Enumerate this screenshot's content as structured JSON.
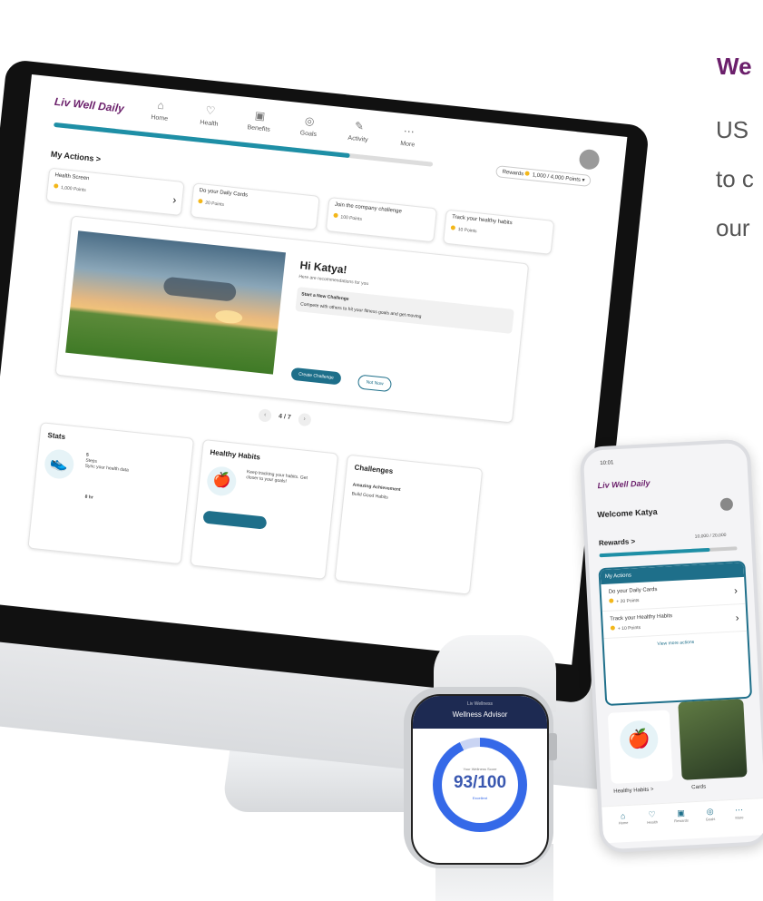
{
  "side_text": {
    "heading": "We",
    "line1": "US",
    "line2": "to c",
    "line3": "our"
  },
  "monitor": {
    "logo": "Liv Well Daily",
    "nav": [
      "Home",
      "Health",
      "Benefits",
      "Goals",
      "Activity",
      "More"
    ],
    "rewards_label": "Rewards",
    "rewards_value": "1,000 / 4,000 Points",
    "section_title": "My Actions >",
    "actions": [
      {
        "label": "Health Screen",
        "points": "1,000 Points"
      },
      {
        "label": "Do your Daily Cards",
        "points": "20 Points"
      },
      {
        "label": "Join the company challenge",
        "points": "100 Points"
      },
      {
        "label": "Track your healthy habits",
        "points": "10 Points"
      }
    ],
    "hero": {
      "greeting": "Hi Katya!",
      "subtitle": "Here are recommendations for you",
      "challenge_title": "Start a New Challenge",
      "challenge_text": "Compete with others to hit your fitness goals and get moving",
      "primary_btn": "Create Challenge",
      "secondary_btn": "Not Now"
    },
    "pager": "4 / 7",
    "stats": {
      "title": "Stats",
      "steps": "5",
      "steps_label": "Steps",
      "steps_sub": "Sync your health data",
      "sleep": "8 hr"
    },
    "habits": {
      "title": "Healthy Habits",
      "text": "Keep tracking your habits. Get closer to your goals!"
    },
    "challenges": {
      "title": "Challenges",
      "item": "Amazing Achievement",
      "sub": "Build Good Habits"
    }
  },
  "phone": {
    "time": "10:01",
    "logo": "Liv Well Daily",
    "welcome": "Welcome Katya",
    "rewards": "Rewards >",
    "points": "10,000 / 20,000",
    "actions_header": "My Actions",
    "actions": [
      {
        "label": "Do your Daily Cards",
        "points": "+ 20 Points"
      },
      {
        "label": "Track your Healthy Habits",
        "points": "+ 10 Points"
      }
    ],
    "view_more": "View more actions",
    "tile1": "Healthy Habits >",
    "tile2": "Cards",
    "tabs": [
      "Home",
      "Health",
      "Rewards",
      "Goals",
      "More"
    ]
  },
  "watch": {
    "sub": "Liv Wellness",
    "title": "Wellness Advisor",
    "score_label": "Your Wellness Score",
    "score": "93/100",
    "score_sub": "Excellent",
    "score_value": 93
  }
}
